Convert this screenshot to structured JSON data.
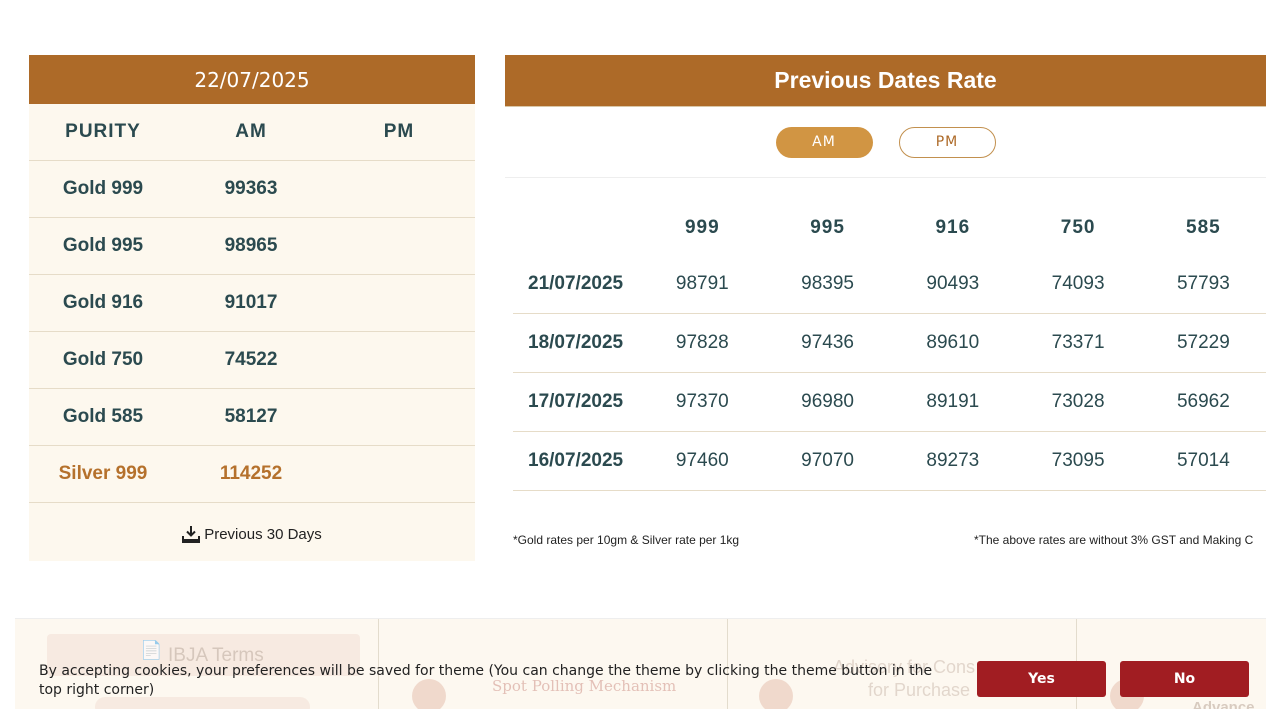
{
  "today": {
    "date": "22/07/2025",
    "headers": [
      "PURITY",
      "AM",
      "PM"
    ],
    "rows": [
      {
        "purity": "Gold 999",
        "am": "99363",
        "pm": ""
      },
      {
        "purity": "Gold 995",
        "am": "98965",
        "pm": ""
      },
      {
        "purity": "Gold 916",
        "am": "91017",
        "pm": ""
      },
      {
        "purity": "Gold 750",
        "am": "74522",
        "pm": ""
      },
      {
        "purity": "Gold 585",
        "am": "58127",
        "pm": ""
      },
      {
        "purity": "Silver 999",
        "am": "114252",
        "pm": ""
      }
    ],
    "download_label": "Previous 30 Days"
  },
  "previous": {
    "title": "Previous Dates Rate",
    "tabs": {
      "am": "AM",
      "pm": "PM",
      "active": "AM"
    },
    "columns": [
      "999",
      "995",
      "916",
      "750",
      "585"
    ],
    "rows": [
      {
        "date": "21/07/2025",
        "values": [
          "98791",
          "98395",
          "90493",
          "74093",
          "57793"
        ]
      },
      {
        "date": "18/07/2025",
        "values": [
          "97828",
          "97436",
          "89610",
          "73371",
          "57229"
        ]
      },
      {
        "date": "17/07/2025",
        "values": [
          "97370",
          "96980",
          "89191",
          "73028",
          "56962"
        ]
      },
      {
        "date": "16/07/2025",
        "values": [
          "97460",
          "97070",
          "89273",
          "73095",
          "57014"
        ]
      }
    ],
    "footnote_left": "*Gold rates per 10gm & Silver rate per 1kg",
    "footnote_right": "*The above rates are without 3% GST and Making C"
  },
  "background_cards": {
    "card1": "IBJA Terms",
    "card2": "Spot Polling Mechanism",
    "card3_line1": "Advisory for Cons",
    "card3_line2": "for Purchase",
    "card4": "Advance in"
  },
  "cookie": {
    "message": "By accepting cookies, your preferences will be saved for theme (You can change the theme by clicking the theme button in the top right corner)",
    "yes": "Yes",
    "no": "No"
  },
  "colors": {
    "header_brown": "#ad6a28",
    "active_tab": "#d19543",
    "silver_text": "#b5712c",
    "cookie_button": "#a11d22",
    "text_dark": "#2b4a4f"
  }
}
